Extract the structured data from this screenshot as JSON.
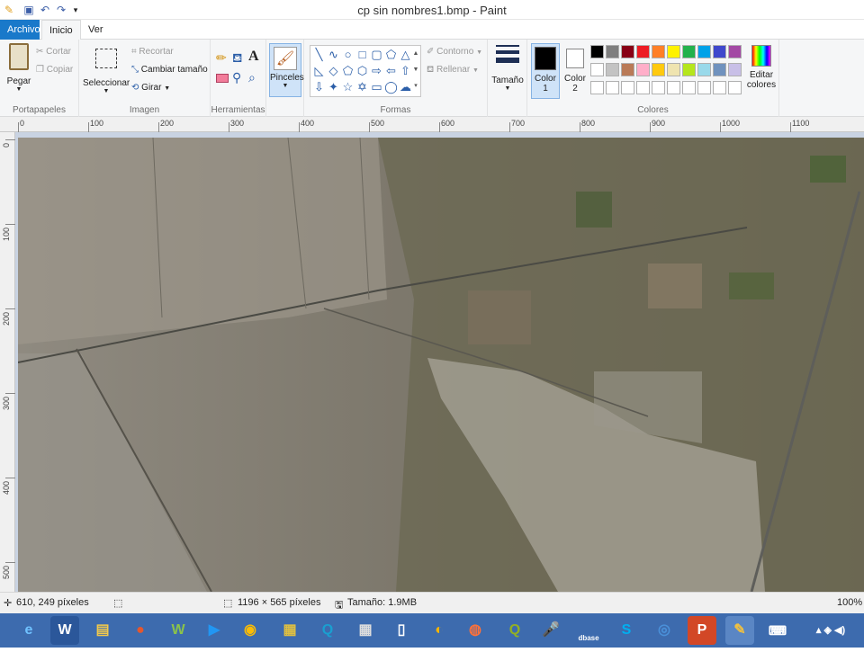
{
  "window": {
    "title": "cp sin nombres1.bmp - Paint"
  },
  "tabs": [
    {
      "label": "Archivo"
    },
    {
      "label": "Inicio"
    },
    {
      "label": "Ver"
    }
  ],
  "ribbon": {
    "portapapeles": {
      "label": "Portapapeles",
      "pegar": "Pegar",
      "cortar": "Cortar",
      "copiar": "Copiar"
    },
    "imagen": {
      "label": "Imagen",
      "seleccionar": "Seleccionar",
      "recortar": "Recortar",
      "cambiar_tamano": "Cambiar tamaño",
      "girar": "Girar"
    },
    "herramientas": {
      "label": "Herramientas",
      "text_tool": "A"
    },
    "pinceles": {
      "label": "Pinceles"
    },
    "formas": {
      "label": "Formas",
      "contorno": "Contorno",
      "rellenar": "Rellenar"
    },
    "tamano": {
      "label": "Tamaño"
    },
    "colores": {
      "label": "Colores",
      "color1": "Color",
      "color1_num": "1",
      "color2": "Color",
      "color2_num": "2",
      "editar1": "Editar",
      "editar2": "colores",
      "color1_value": "#000000",
      "color2_value": "#ffffff",
      "palette_row1": [
        "#000000",
        "#7f7f7f",
        "#880015",
        "#ed1c24",
        "#ff7f27",
        "#fff200",
        "#22b14c",
        "#00a2e8",
        "#3f48cc",
        "#a349a4"
      ],
      "palette_row2": [
        "#ffffff",
        "#c3c3c3",
        "#b97a57",
        "#ffaec9",
        "#ffc90e",
        "#efe4b0",
        "#b5e61d",
        "#99d9ea",
        "#7092be",
        "#c8bfe7"
      ]
    }
  },
  "ruler_h": [
    "0",
    "100",
    "200",
    "300",
    "400",
    "500",
    "600",
    "700",
    "800",
    "900",
    "1000",
    "1100"
  ],
  "ruler_v": [
    "0",
    "100",
    "200",
    "300",
    "400",
    "500"
  ],
  "status": {
    "cursor_pos": "610, 249 píxeles",
    "image_size": "1196 × 565 píxeles",
    "file_size": "Tamaño: 1.9MB",
    "zoom": "100%"
  },
  "taskbar": {
    "word_label": "W",
    "dbase_label": "dbase"
  }
}
